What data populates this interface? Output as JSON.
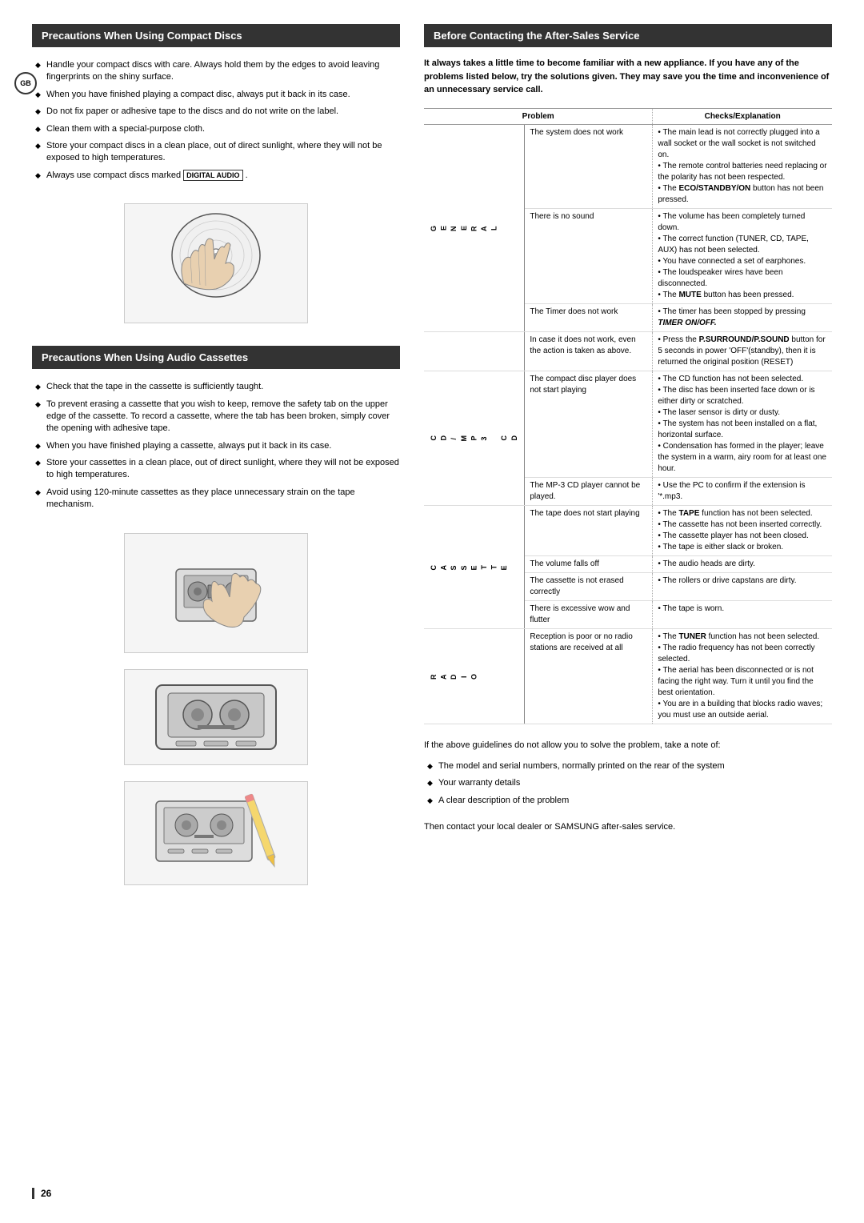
{
  "page": {
    "number": "26",
    "gb_badge": "GB"
  },
  "left_section1": {
    "title": "Precautions When Using Compact Discs",
    "bullets": [
      "Handle your compact discs with care. Always hold them by the edges to avoid leaving fingerprints on the shiny surface.",
      "When you have finished playing a compact disc, always put it back in its case.",
      "Do not fix paper or adhesive tape to the discs and do not write on the label.",
      "Clean them with a special-purpose cloth.",
      "Store your compact discs in a clean place, out of direct sunlight, where they will not be exposed to high temperatures.",
      "Always use compact discs marked [DIGITAL AUDIO]."
    ],
    "image_alt": "Hand holding compact disc"
  },
  "left_section2": {
    "title": "Precautions When Using Audio Cassettes",
    "bullets": [
      "Check that the tape in the cassette is sufficiently taught.",
      "To prevent erasing a cassette that you wish to keep, remove the safety tab on the upper edge of the cassette. To record a cassette, where the tab has been broken, simply cover the opening with adhesive tape.",
      "When you have finished playing a cassette, always put it back in its case.",
      "Store your cassettes in a clean place, out of direct sunlight, where they will not be exposed to high temperatures.",
      "Avoid using 120-minute cassettes as they place unnecessary strain on the tape mechanism."
    ],
    "image1_alt": "Cassette tape loading",
    "image2_alt": "Cassette tape close-up",
    "image3_alt": "Cassette tape with pencil"
  },
  "right_section": {
    "title": "Before Contacting the After-Sales Service",
    "intro_bold": "It always takes a little time to become familiar with a new appliance. If you have any of the problems listed below, try the solutions given. They may save you the time and inconvenience of an unnecessary service call.",
    "table": {
      "col_problem": "Problem",
      "col_checks": "Checks/Explanation",
      "rows": [
        {
          "section_label": "",
          "problem": "The system does not work",
          "checks": [
            "• The main lead is not correctly plugged into a wall socket or the wall socket is not switched on.",
            "• The remote control batteries need replacing or the polarity has not been respected.",
            "• The ECO/STANDBY/ON button has not been pressed."
          ]
        },
        {
          "section_label": "G E N E R A L",
          "problem": "There is no sound",
          "checks": [
            "• The volume has been completely turned down.",
            "• The correct function (TUNER, CD, TAPE, AUX) has not been selected.",
            "• You have connected a set of earphones.",
            "• The loudspeaker wires have been disconnected.",
            "• The MUTE button has been pressed."
          ]
        },
        {
          "section_label": "",
          "problem": "The Timer does not work",
          "checks": [
            "• The timer has been stopped by pressing TIMER ON/OFF."
          ]
        },
        {
          "section_label": "",
          "problem": "In case it does not work, even the action is taken as above.",
          "checks": [
            "• Press the P.SURROUND/P.SOUND button for 5 seconds in power 'OFF'(standby), then it is returned the original position (RESET)"
          ]
        },
        {
          "section_label": "C D / M P 3 C D",
          "problem": "The compact disc player does not start playing",
          "checks": [
            "• The CD function has not been selected.",
            "• The disc has been inserted face down or is either dirty or scratched.",
            "• The laser sensor is dirty or dusty.",
            "• The system has not been installed on a flat, horizontal surface.",
            "• Condensation has formed in the player; leave the system in a warm, airy room for at least one hour."
          ]
        },
        {
          "section_label": "",
          "problem": "The MP-3 CD player cannot be played.",
          "checks": [
            "• Use the PC to confirm if the extension is '*.mp3."
          ]
        },
        {
          "section_label": "C A S S E T T E",
          "problem": "The tape does not start playing",
          "checks": [
            "• The TAPE function has not been selected.",
            "• The cassette has not been inserted correctly.",
            "• The cassette player has not been closed.",
            "• The tape is either slack or broken."
          ]
        },
        {
          "section_label": "",
          "problem": "The volume falls off",
          "checks": [
            "• The audio heads are dirty."
          ]
        },
        {
          "section_label": "",
          "problem": "The cassette is not erased correctly",
          "checks": [
            "• The rollers or drive capstans are dirty."
          ]
        },
        {
          "section_label": "",
          "problem": "There is excessive wow and flutter",
          "checks": [
            "• The tape is worn."
          ]
        },
        {
          "section_label": "R A D I O",
          "problem": "Reception is poor or no radio stations are received at all",
          "checks": [
            "• The TUNER function has not been selected.",
            "• The radio frequency has not been correctly selected.",
            "• The aerial has been disconnected or is not facing the right way. Turn it until you find the best orientation.",
            "• You are in a building that blocks radio waves; you must use an outside aerial."
          ]
        }
      ]
    },
    "bottom_text": "If the above guidelines do not allow you to solve the problem, take a note of:",
    "bottom_bullets": [
      "The model and serial numbers, normally printed on the rear of the system",
      "Your warranty details",
      "A clear description of the problem"
    ],
    "bottom_contact": "Then contact your local dealer or SAMSUNG after-sales service."
  }
}
